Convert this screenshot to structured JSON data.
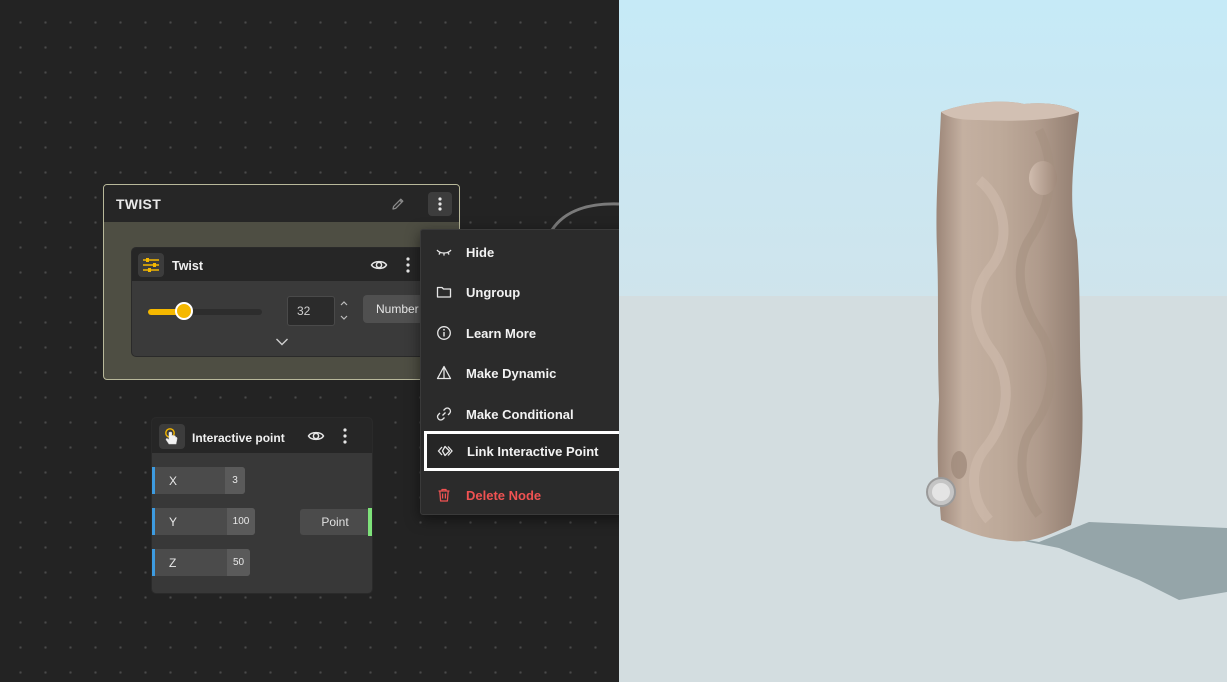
{
  "group": {
    "title": "TWIST",
    "icons": {
      "edit": "pencil-icon",
      "menu": "kebab-icon"
    }
  },
  "twist_node": {
    "title": "Twist",
    "icon": "sliders-icon",
    "slider_value": 32,
    "slider_min": 0,
    "slider_max": 100,
    "value_display": "32",
    "type_label": "Number",
    "accent_color": "#f5b800"
  },
  "interactive_point_node": {
    "title": "Interactive point",
    "icon": "hand-pointer-icon",
    "coords": [
      {
        "label": "X",
        "value": "3"
      },
      {
        "label": "Y",
        "value": "100"
      },
      {
        "label": "Z",
        "value": "50"
      }
    ],
    "output_label": "Point",
    "input_socket_color": "#3d9be0",
    "output_socket_color": "#7ee27a"
  },
  "context_menu": {
    "items": [
      {
        "label": "Hide",
        "icon": "eye-closed-icon"
      },
      {
        "label": "Ungroup",
        "icon": "folder-icon"
      },
      {
        "label": "Learn More",
        "icon": "info-icon"
      },
      {
        "label": "Make Dynamic",
        "icon": "pyramid-icon"
      },
      {
        "label": "Make Conditional",
        "icon": "link-icon"
      },
      {
        "label": "Link Interactive Point",
        "icon": "link-point-icon",
        "highlighted": true
      },
      {
        "label": "Delete Node",
        "icon": "trash-icon",
        "danger": true
      }
    ],
    "danger_color": "#f05252"
  },
  "viewport": {
    "sky_color": "#c7eaf6",
    "ground_color": "#d3dde0",
    "model_color": "#b9a597",
    "shadow_color": "#8e9ea3"
  }
}
